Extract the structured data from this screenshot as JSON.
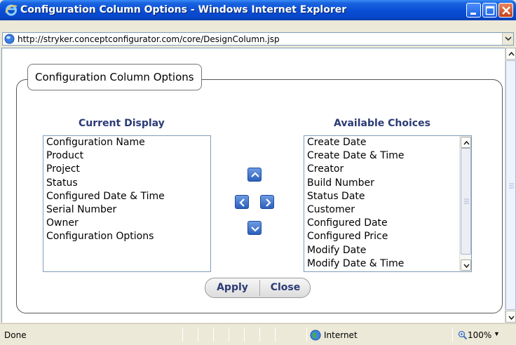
{
  "window": {
    "title": "Configuration Column Options - Windows Internet Explorer"
  },
  "address": {
    "url": "http://stryker.conceptconfigurator.com/core/DesignColumn.jsp"
  },
  "panel": {
    "legend": "Configuration Column Options"
  },
  "current": {
    "heading": "Current Display",
    "items": [
      "Configuration Name",
      "Product",
      "Project",
      "Status",
      "Configured Date & Time",
      "Serial Number",
      "Owner",
      "Configuration Options"
    ]
  },
  "available": {
    "heading": "Available Choices",
    "items": [
      "Create Date",
      "Create Date & Time",
      "Creator",
      "Build Number",
      "Status Date",
      "Customer",
      "Configured Date",
      "Configured Price",
      "Modify Date",
      "Modify Date & Time"
    ]
  },
  "buttons": {
    "apply": "Apply",
    "close": "Close"
  },
  "status": {
    "text": "Done",
    "zone": "Internet",
    "zoom": "100%"
  },
  "icons": {
    "move_up": "chevron-up-icon",
    "move_left": "chevron-left-icon",
    "move_right": "chevron-right-icon",
    "move_down": "chevron-down-icon"
  },
  "colors": {
    "heading": "#2b3b76",
    "titlebar": "#0a4fd6",
    "arrow_button": "#2b5fbb"
  }
}
